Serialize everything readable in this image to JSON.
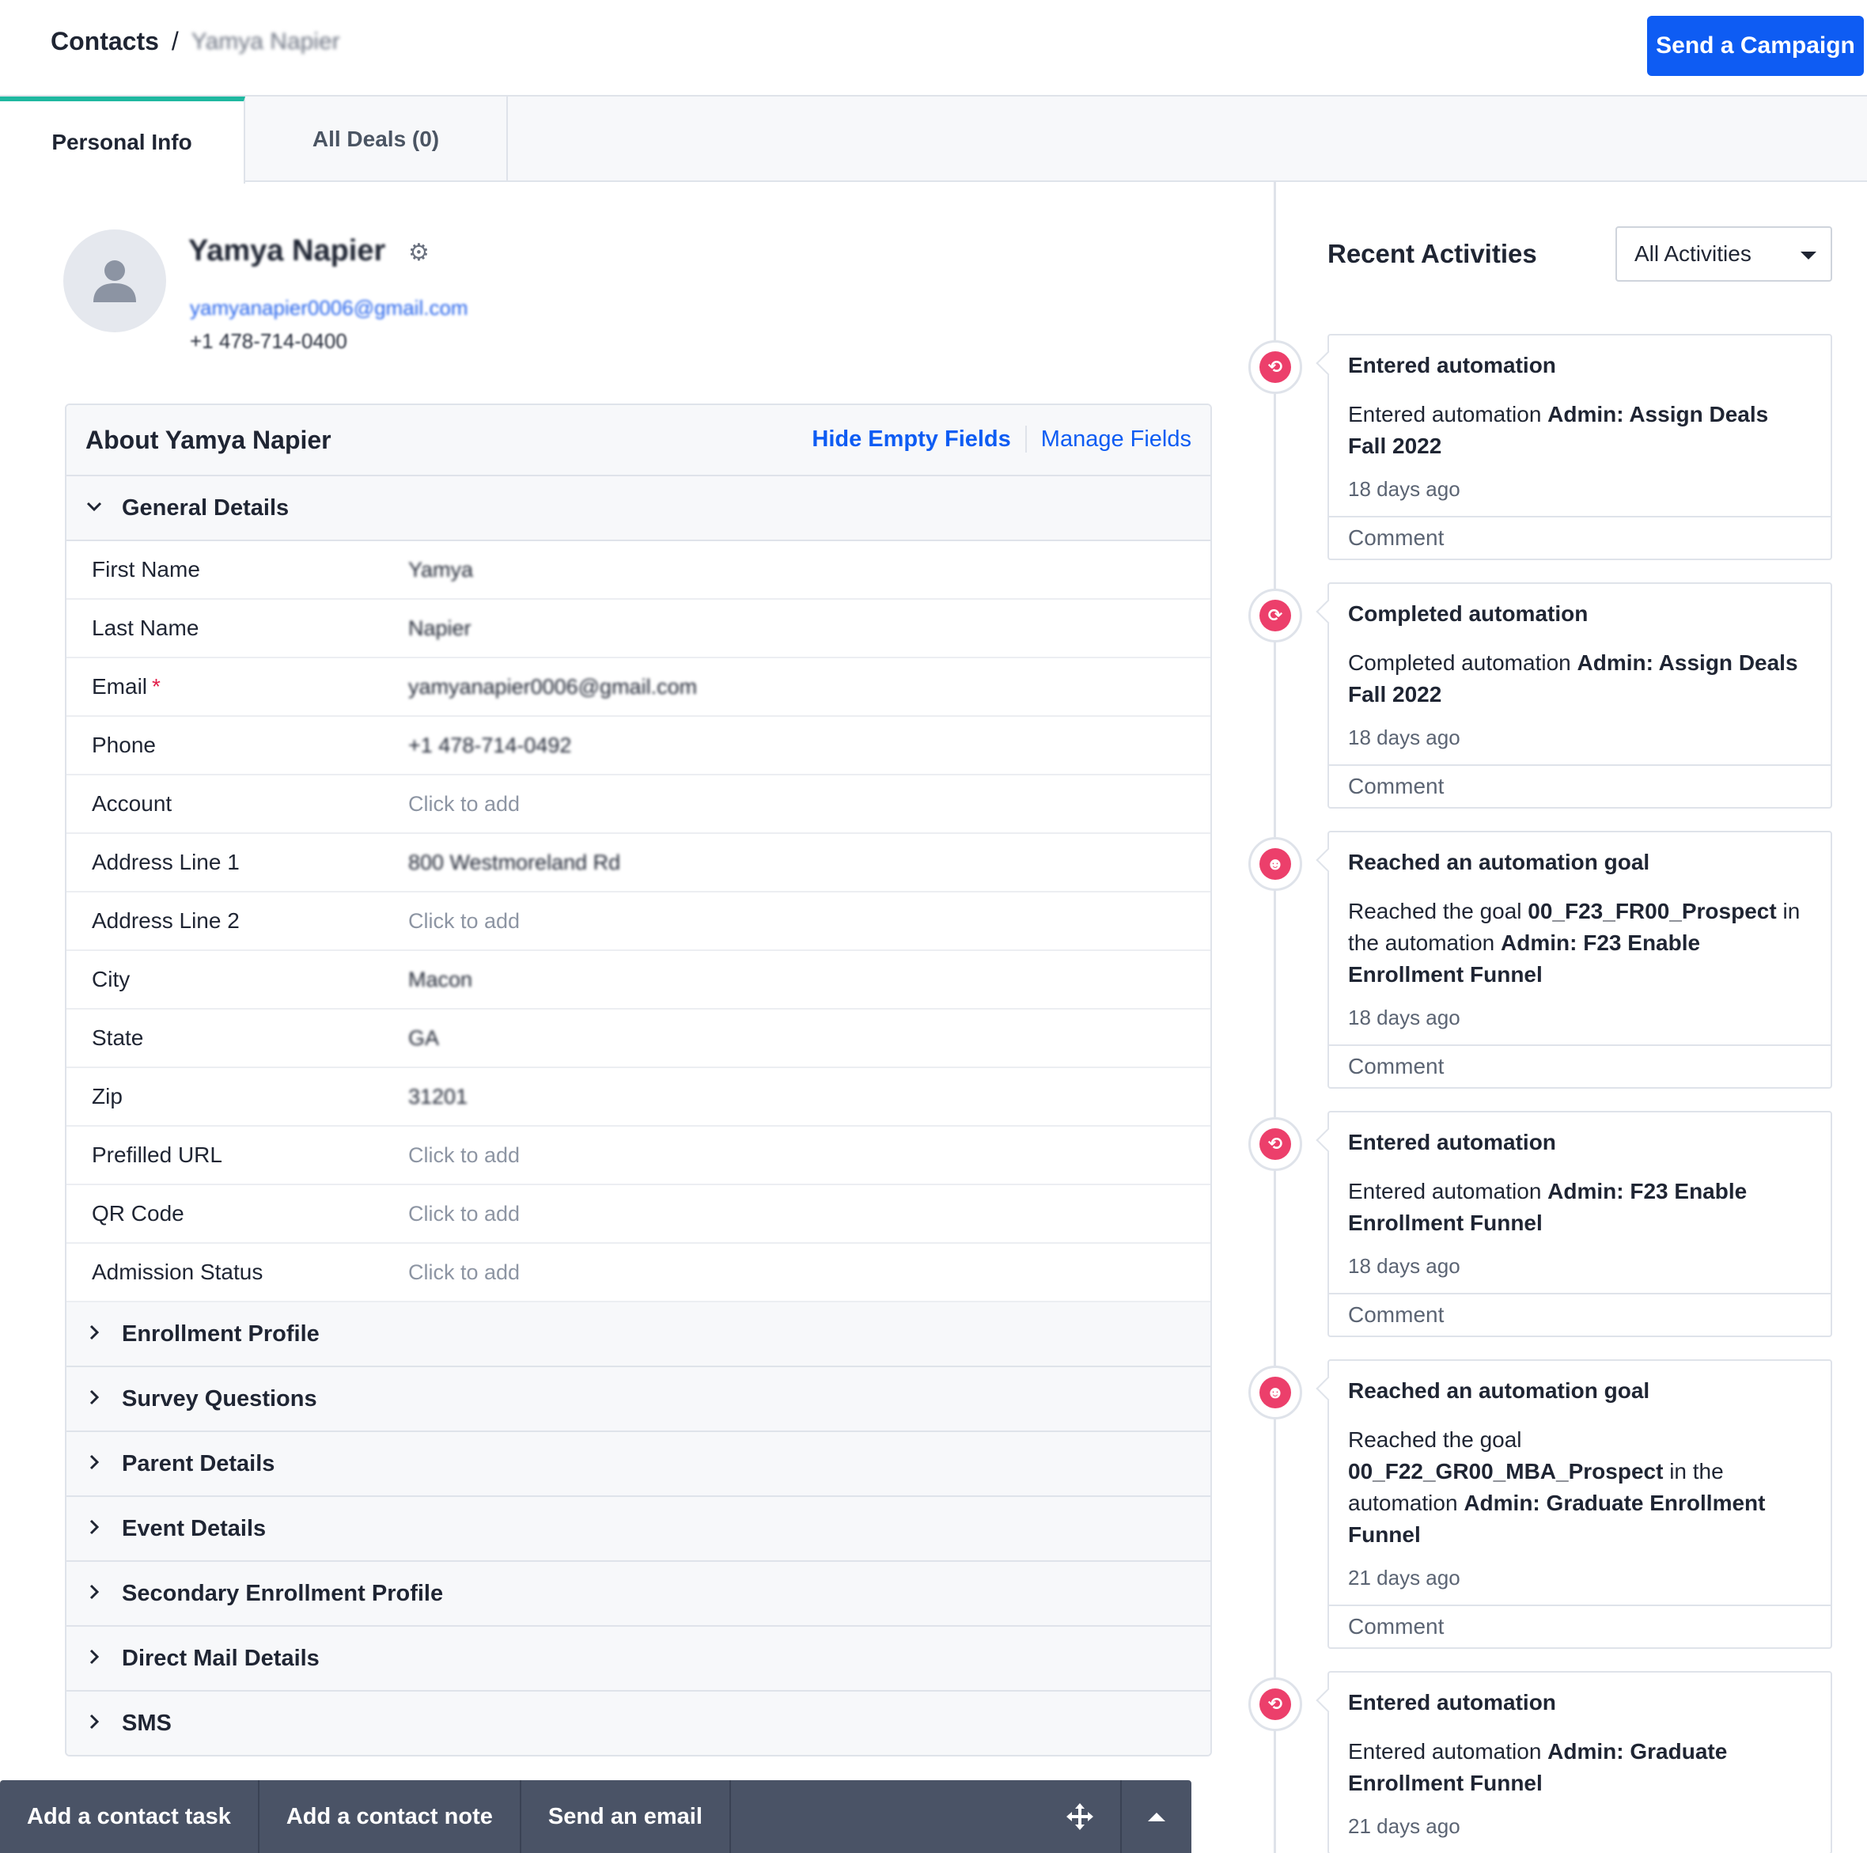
{
  "header": {
    "breadcrumb_root": "Contacts",
    "breadcrumb_sep": "/",
    "breadcrumb_current": "Yamya Napier",
    "send_campaign_label": "Send a Campaign",
    "accent_color": "#0e5cf3"
  },
  "tabs": [
    {
      "label": "Personal Info",
      "active": true
    },
    {
      "label": "All Deals (0)",
      "active": false
    }
  ],
  "profile": {
    "name": "Yamya Napier",
    "email": "yamyanapier0006@gmail.com",
    "phone": "+1 478-714-0400",
    "avatar_icon": "person-icon",
    "settings_icon": "gear-icon"
  },
  "about": {
    "title": "About Yamya Napier",
    "hide_empty_label": "Hide Empty Fields",
    "manage_fields_label": "Manage Fields",
    "general_section": "General Details",
    "fields": [
      {
        "label": "First Name",
        "value": "Yamya",
        "blurred": true
      },
      {
        "label": "Last Name",
        "value": "Napier",
        "blurred": true
      },
      {
        "label": "Email",
        "value": "yamyanapier0006@gmail.com",
        "blurred": true,
        "required": true
      },
      {
        "label": "Phone",
        "value": "+1 478-714-0492",
        "blurred": true
      },
      {
        "label": "Account",
        "value": "Click to add",
        "empty": true
      },
      {
        "label": "Address Line 1",
        "value": "800 Westmoreland Rd",
        "blurred": true
      },
      {
        "label": "Address Line 2",
        "value": "Click to add",
        "empty": true
      },
      {
        "label": "City",
        "value": "Macon",
        "blurred": true
      },
      {
        "label": "State",
        "value": "GA",
        "blurred": true
      },
      {
        "label": "Zip",
        "value": "31201",
        "blurred": true
      },
      {
        "label": "Prefilled URL",
        "value": "Click to add",
        "empty": true
      },
      {
        "label": "QR Code",
        "value": "Click to add",
        "empty": true
      },
      {
        "label": "Admission Status",
        "value": "Click to add",
        "empty": true
      }
    ],
    "collapsed_sections": [
      "Enrollment Profile",
      "Survey Questions",
      "Parent Details",
      "Event Details",
      "Secondary Enrollment Profile",
      "Direct Mail Details",
      "SMS"
    ]
  },
  "activities": {
    "title": "Recent Activities",
    "filter_value": "All Activities",
    "comment_label": "Comment",
    "status_color": "#ec3f6b",
    "items": [
      {
        "icon": "automation-enter-icon",
        "glyph": "⟲",
        "title": "Entered automation",
        "desc_pre": "Entered automation ",
        "desc_bold": "Admin: Assign Deals Fall 2022",
        "desc_mid": "",
        "desc_bold2": "",
        "time": "18 days ago",
        "has_comment": true
      },
      {
        "icon": "automation-complete-icon",
        "glyph": "⟳",
        "title": "Completed automation",
        "desc_pre": "Completed automation ",
        "desc_bold": "Admin: Assign Deals Fall 2022",
        "desc_mid": "",
        "desc_bold2": "",
        "time": "18 days ago",
        "has_comment": true
      },
      {
        "icon": "goal-robot-icon",
        "glyph": "☻",
        "title": "Reached an automation goal",
        "desc_pre": "Reached the goal ",
        "desc_bold": "00_F23_FR00_Prospect",
        "desc_mid": " in the automation ",
        "desc_bold2": "Admin: F23 Enable Enrollment Funnel",
        "time": "18 days ago",
        "has_comment": true
      },
      {
        "icon": "automation-enter-icon",
        "glyph": "⟲",
        "title": "Entered automation",
        "desc_pre": "Entered automation ",
        "desc_bold": "Admin: F23 Enable Enrollment Funnel",
        "desc_mid": "",
        "desc_bold2": "",
        "time": "18 days ago",
        "has_comment": true
      },
      {
        "icon": "goal-robot-icon",
        "glyph": "☻",
        "title": "Reached an automation goal",
        "desc_pre": "Reached the goal ",
        "desc_bold": "00_F22_GR00_MBA_Prospect",
        "desc_mid": " in the automation ",
        "desc_bold2": "Admin: Graduate Enrollment Funnel",
        "time": "21 days ago",
        "has_comment": true
      },
      {
        "icon": "automation-enter-icon",
        "glyph": "⟲",
        "title": "Entered automation",
        "desc_pre": "Entered automation ",
        "desc_bold": "Admin: Graduate Enrollment Funnel",
        "desc_mid": "",
        "desc_bold2": "",
        "time": "21 days ago",
        "has_comment": false
      }
    ]
  },
  "bottom_bar": {
    "task_label": "Add a contact task",
    "note_label": "Add a contact note",
    "email_label": "Send an email",
    "move_icon": "move-icon",
    "expand_icon": "caret-up-icon"
  }
}
